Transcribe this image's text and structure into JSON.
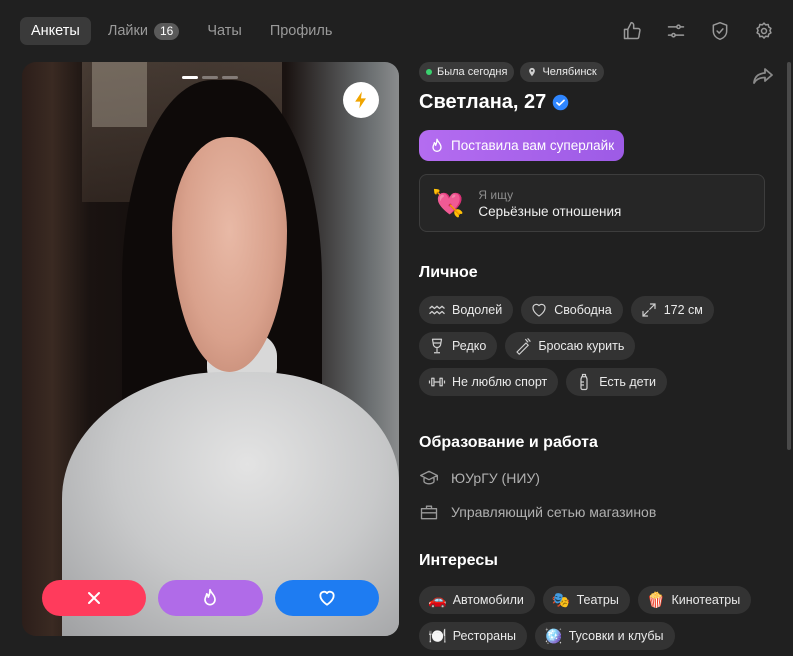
{
  "nav": {
    "tabs": [
      {
        "label": "Анкеты"
      },
      {
        "label": "Лайки",
        "badge": "16"
      },
      {
        "label": "Чаты"
      },
      {
        "label": "Профиль"
      }
    ]
  },
  "top_icons": [
    "thumbs-up-icon",
    "sliders-icon",
    "shield-check-icon",
    "gear-icon"
  ],
  "photo": {
    "actions": [
      "close-icon",
      "flame-icon",
      "heart-icon"
    ],
    "colors": {
      "dislike": "#ff3b5c",
      "superlike": "#b06be8",
      "like": "#1e7cf2"
    }
  },
  "profile": {
    "status": "Была сегодня",
    "city": "Челябинск",
    "name": "Светлана, 27",
    "superlike": "Поставила вам суперлайк",
    "seek_label": "Я ищу",
    "seek_value": "Серьёзные отношения",
    "personal_title": "Личное",
    "personal": {
      "zodiac": "Водолей",
      "relationship": "Свободна",
      "height": "172 см",
      "alcohol": "Редко",
      "smoking": "Бросаю курить",
      "sport": "Не люблю спорт",
      "kids": "Есть дети"
    },
    "edu_title": "Образование и работа",
    "university": "ЮУрГУ (НИУ)",
    "job": "Управляющий сетью магазинов",
    "interests_title": "Интересы",
    "interests": {
      "cars": "Автомобили",
      "theatres": "Театры",
      "cinemas": "Кинотеатры",
      "restaurants": "Рестораны",
      "parties": "Тусовки и клубы"
    }
  }
}
